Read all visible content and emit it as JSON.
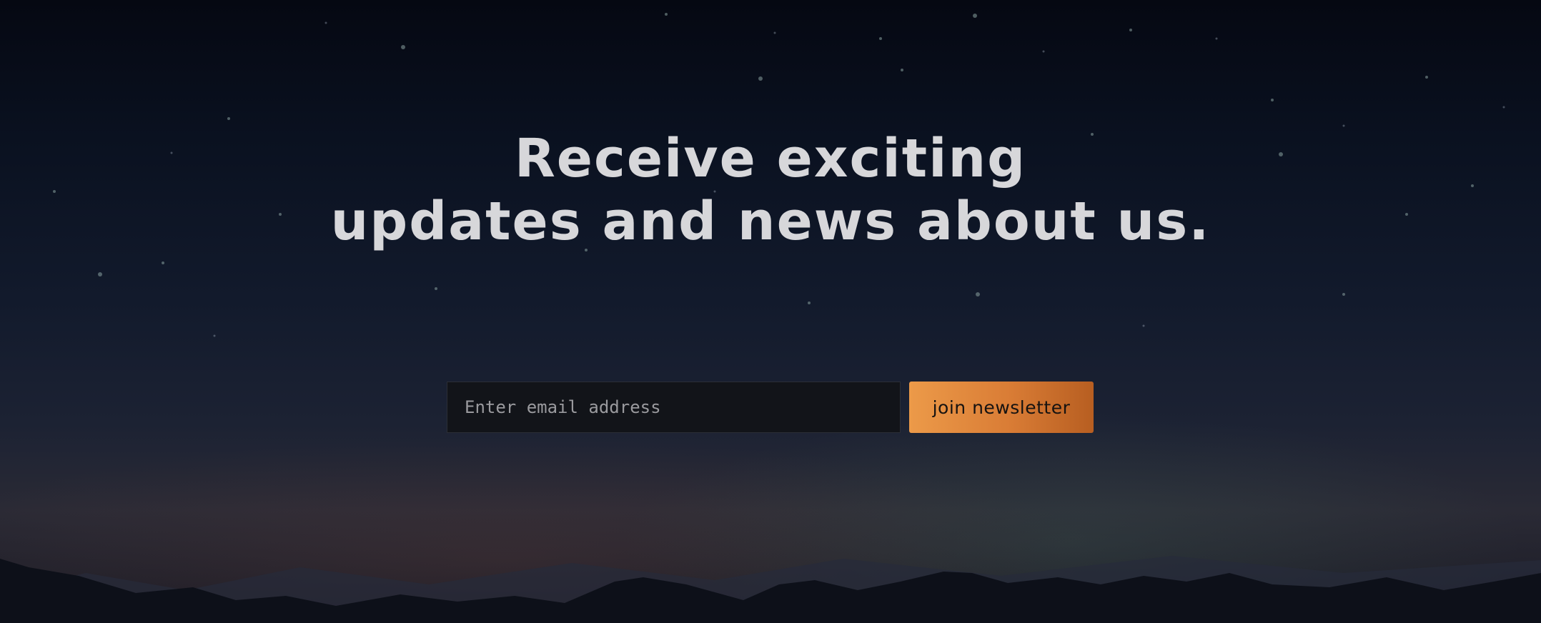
{
  "headline": {
    "line1": "Receive exciting",
    "line2": "updates and news about us."
  },
  "newsletter": {
    "email_placeholder": "Enter email address",
    "email_value": "",
    "join_label": "join newsletter"
  },
  "colors": {
    "sky_top": "#050812",
    "sky_horizon": "#2a2a35",
    "headline_text": "#d7d7da",
    "input_bg": "#121419",
    "button_orange": "#ec9a49",
    "button_dark_orange": "#b75e21"
  }
}
